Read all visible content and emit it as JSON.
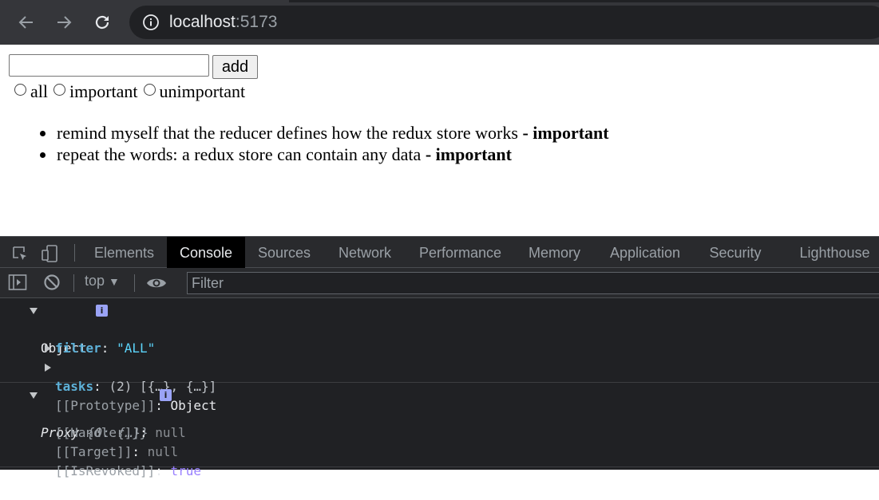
{
  "browser": {
    "url_host": "localhost",
    "url_port": ":5173"
  },
  "app": {
    "input_value": "",
    "add_label": "add",
    "filters": [
      {
        "label": "all"
      },
      {
        "label": "important"
      },
      {
        "label": "unimportant"
      }
    ],
    "notes": [
      {
        "text": "remind myself that the reducer defines how the redux store works ",
        "status": "- important"
      },
      {
        "text": "repeat the words: a redux store can contain any data ",
        "status": "- important"
      }
    ]
  },
  "devtools": {
    "tabs": [
      "Elements",
      "Console",
      "Sources",
      "Network",
      "Performance",
      "Memory",
      "Application",
      "Security",
      "Lighthouse"
    ],
    "active_tab": "Console",
    "context": "top",
    "filter_placeholder": "Filter",
    "log1": {
      "header": "Object",
      "filter_key": "filter",
      "filter_value": "\"ALL\"",
      "tasks_key": "tasks",
      "tasks_value": "(2) [{…}, {…}]",
      "prototype_key": "[[Prototype]]",
      "prototype_value": "Object"
    },
    "log2": {
      "header_name": "Proxy",
      "header_preview": "{0: {…}}",
      "handler_key": "[[Handler]]",
      "handler_value": "null",
      "target_key": "[[Target]]",
      "target_value": "null",
      "revoked_key": "[[IsRevoked]]",
      "revoked_value": "true"
    },
    "info_badge": "i"
  }
}
